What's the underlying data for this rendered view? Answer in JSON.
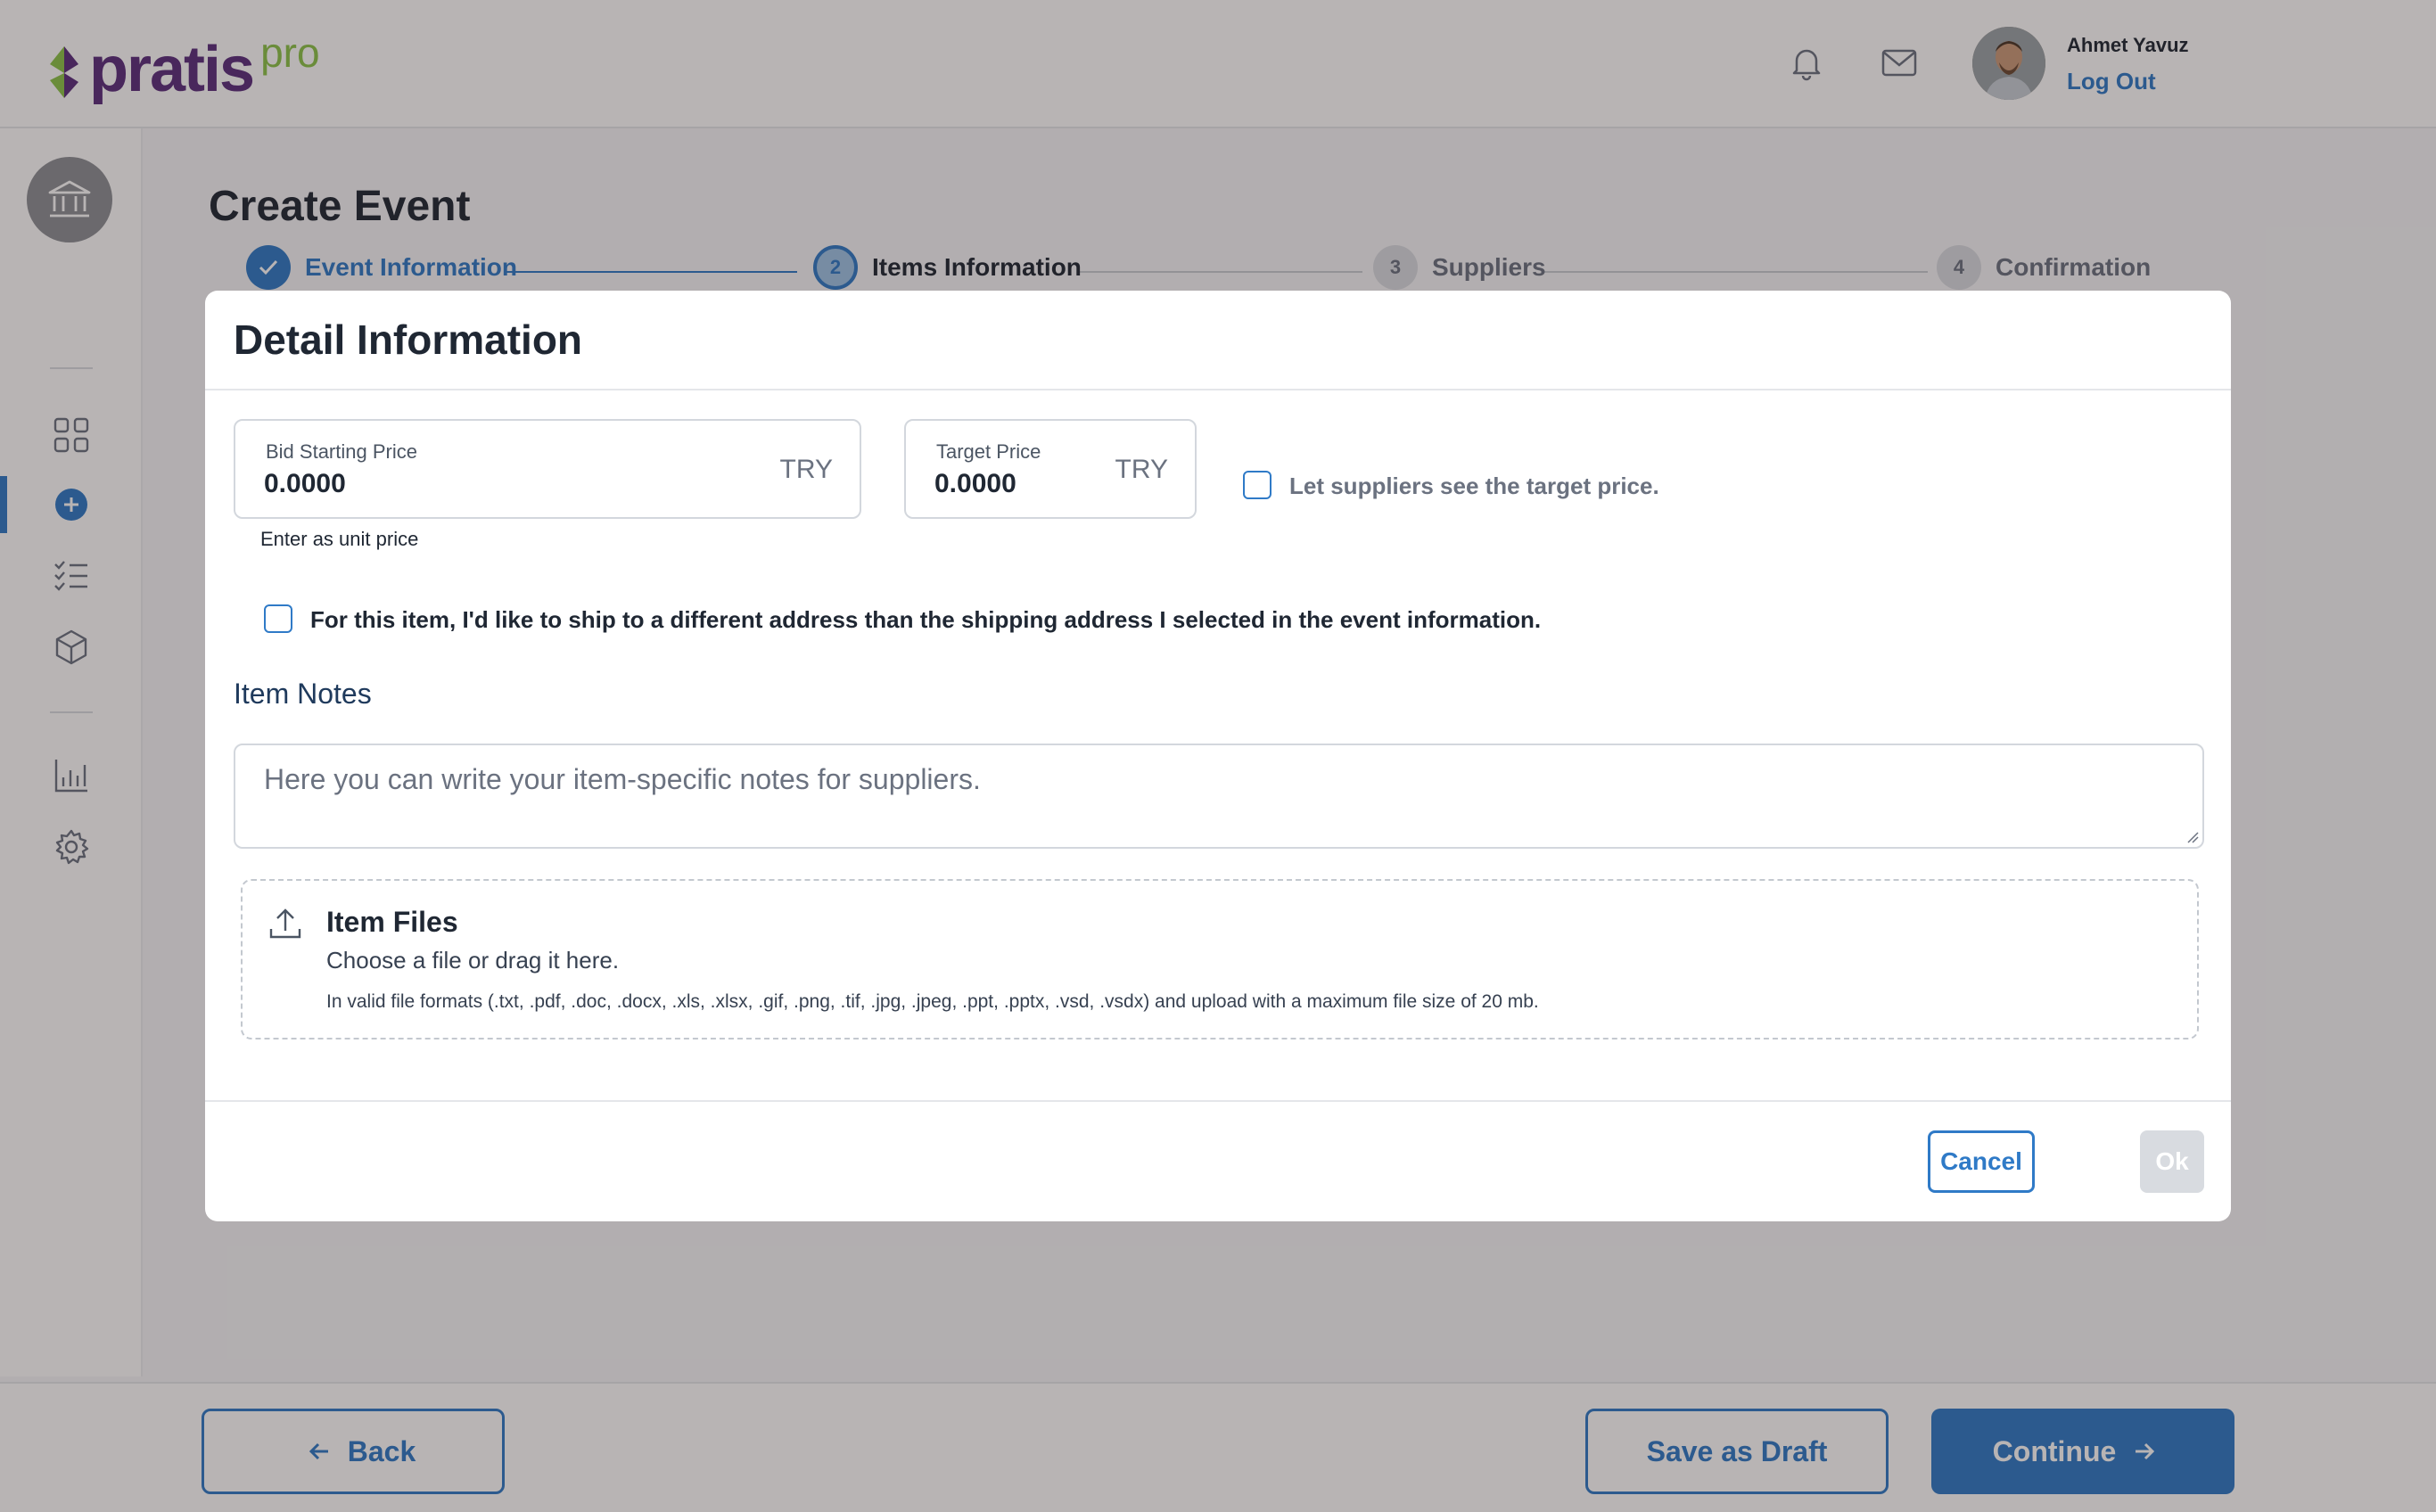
{
  "header": {
    "logo_text": "pratis",
    "logo_pro": "pro",
    "user_name": "Ahmet Yavuz",
    "logout_label": "Log Out"
  },
  "sidebar": {
    "items": [
      {
        "icon": "grid-icon"
      },
      {
        "icon": "plus-circle-icon",
        "active": true
      },
      {
        "icon": "checklist-icon"
      },
      {
        "icon": "box-icon"
      },
      {
        "icon": "chart-icon"
      },
      {
        "icon": "gear-icon"
      }
    ]
  },
  "page": {
    "title": "Create Event"
  },
  "stepper": {
    "steps": [
      {
        "number": "",
        "label": "Event Information",
        "state": "done"
      },
      {
        "number": "2",
        "label": "Items Information",
        "state": "current"
      },
      {
        "number": "3",
        "label": "Suppliers",
        "state": "pending"
      },
      {
        "number": "4",
        "label": "Confirmation",
        "state": "pending"
      }
    ]
  },
  "modal": {
    "title": "Detail Information",
    "bid_field": {
      "label": "Bid Starting Price",
      "value": "0.0000",
      "currency": "TRY",
      "hint": "Enter as unit price"
    },
    "target_field": {
      "label": "Target Price",
      "value": "0.0000",
      "currency": "TRY"
    },
    "target_visible_checkbox": {
      "label": "Let suppliers see the target price.",
      "checked": false
    },
    "ship_checkbox": {
      "label": "For this item, I'd like to ship to a different address than the shipping address I selected in the event information.",
      "checked": false
    },
    "notes": {
      "title": "Item Notes",
      "placeholder": "Here you can write your item-specific notes for suppliers."
    },
    "files": {
      "title": "Item Files",
      "subtitle": "Choose a file or drag it here.",
      "note": "In valid file formats (.txt, .pdf, .doc, .docx, .xls, .xlsx, .gif, .png, .tif, .jpg, .jpeg, .ppt, .pptx, .vsd, .vsdx) and upload with a maximum file size of 20 mb."
    },
    "cancel_label": "Cancel",
    "ok_label": "Ok"
  },
  "footer": {
    "back_label": "Back",
    "draft_label": "Save as Draft",
    "continue_label": "Continue"
  },
  "colors": {
    "accent": "#2f7ac7",
    "brand_purple": "#5a2d7d",
    "brand_green": "#8bc34a",
    "overlay": "rgba(40,28,28,0.33)"
  }
}
